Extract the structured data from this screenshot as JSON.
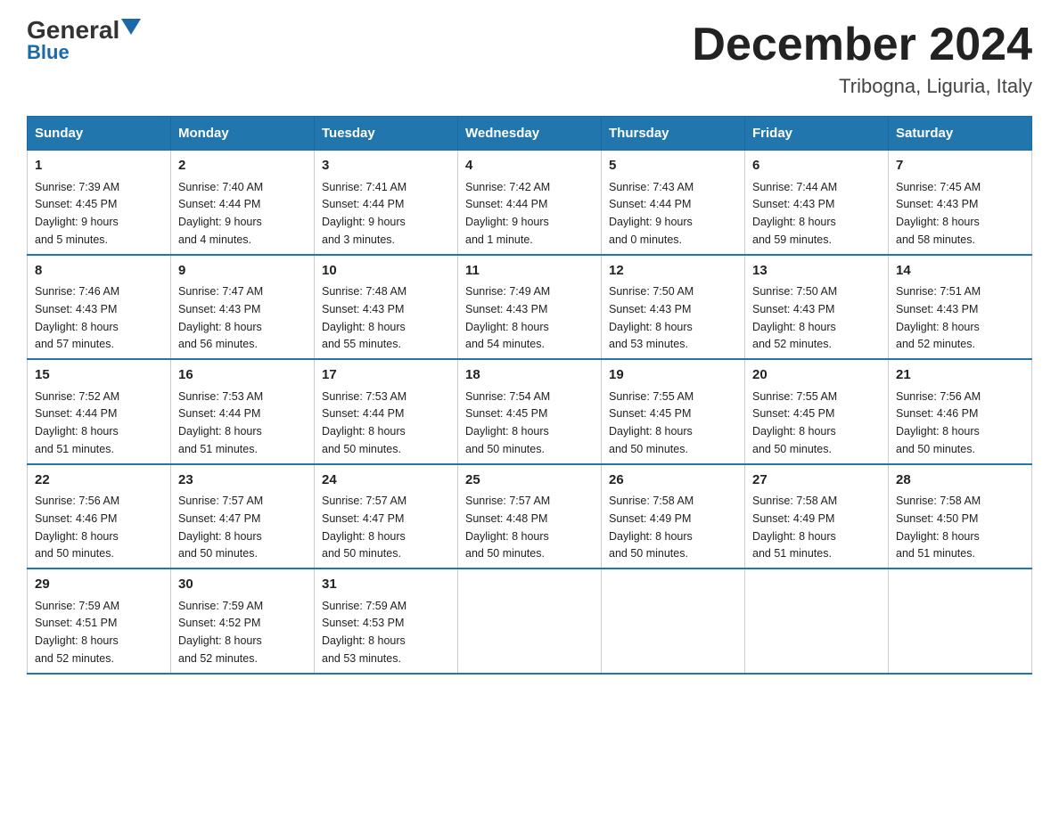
{
  "logo": {
    "general": "General",
    "blue": "Blue"
  },
  "title": "December 2024",
  "subtitle": "Tribogna, Liguria, Italy",
  "weekdays": [
    "Sunday",
    "Monday",
    "Tuesday",
    "Wednesday",
    "Thursday",
    "Friday",
    "Saturday"
  ],
  "weeks": [
    [
      {
        "day": "1",
        "sunrise": "7:39 AM",
        "sunset": "4:45 PM",
        "daylight": "9 hours and 5 minutes."
      },
      {
        "day": "2",
        "sunrise": "7:40 AM",
        "sunset": "4:44 PM",
        "daylight": "9 hours and 4 minutes."
      },
      {
        "day": "3",
        "sunrise": "7:41 AM",
        "sunset": "4:44 PM",
        "daylight": "9 hours and 3 minutes."
      },
      {
        "day": "4",
        "sunrise": "7:42 AM",
        "sunset": "4:44 PM",
        "daylight": "9 hours and 1 minute."
      },
      {
        "day": "5",
        "sunrise": "7:43 AM",
        "sunset": "4:44 PM",
        "daylight": "9 hours and 0 minutes."
      },
      {
        "day": "6",
        "sunrise": "7:44 AM",
        "sunset": "4:43 PM",
        "daylight": "8 hours and 59 minutes."
      },
      {
        "day": "7",
        "sunrise": "7:45 AM",
        "sunset": "4:43 PM",
        "daylight": "8 hours and 58 minutes."
      }
    ],
    [
      {
        "day": "8",
        "sunrise": "7:46 AM",
        "sunset": "4:43 PM",
        "daylight": "8 hours and 57 minutes."
      },
      {
        "day": "9",
        "sunrise": "7:47 AM",
        "sunset": "4:43 PM",
        "daylight": "8 hours and 56 minutes."
      },
      {
        "day": "10",
        "sunrise": "7:48 AM",
        "sunset": "4:43 PM",
        "daylight": "8 hours and 55 minutes."
      },
      {
        "day": "11",
        "sunrise": "7:49 AM",
        "sunset": "4:43 PM",
        "daylight": "8 hours and 54 minutes."
      },
      {
        "day": "12",
        "sunrise": "7:50 AM",
        "sunset": "4:43 PM",
        "daylight": "8 hours and 53 minutes."
      },
      {
        "day": "13",
        "sunrise": "7:50 AM",
        "sunset": "4:43 PM",
        "daylight": "8 hours and 52 minutes."
      },
      {
        "day": "14",
        "sunrise": "7:51 AM",
        "sunset": "4:43 PM",
        "daylight": "8 hours and 52 minutes."
      }
    ],
    [
      {
        "day": "15",
        "sunrise": "7:52 AM",
        "sunset": "4:44 PM",
        "daylight": "8 hours and 51 minutes."
      },
      {
        "day": "16",
        "sunrise": "7:53 AM",
        "sunset": "4:44 PM",
        "daylight": "8 hours and 51 minutes."
      },
      {
        "day": "17",
        "sunrise": "7:53 AM",
        "sunset": "4:44 PM",
        "daylight": "8 hours and 50 minutes."
      },
      {
        "day": "18",
        "sunrise": "7:54 AM",
        "sunset": "4:45 PM",
        "daylight": "8 hours and 50 minutes."
      },
      {
        "day": "19",
        "sunrise": "7:55 AM",
        "sunset": "4:45 PM",
        "daylight": "8 hours and 50 minutes."
      },
      {
        "day": "20",
        "sunrise": "7:55 AM",
        "sunset": "4:45 PM",
        "daylight": "8 hours and 50 minutes."
      },
      {
        "day": "21",
        "sunrise": "7:56 AM",
        "sunset": "4:46 PM",
        "daylight": "8 hours and 50 minutes."
      }
    ],
    [
      {
        "day": "22",
        "sunrise": "7:56 AM",
        "sunset": "4:46 PM",
        "daylight": "8 hours and 50 minutes."
      },
      {
        "day": "23",
        "sunrise": "7:57 AM",
        "sunset": "4:47 PM",
        "daylight": "8 hours and 50 minutes."
      },
      {
        "day": "24",
        "sunrise": "7:57 AM",
        "sunset": "4:47 PM",
        "daylight": "8 hours and 50 minutes."
      },
      {
        "day": "25",
        "sunrise": "7:57 AM",
        "sunset": "4:48 PM",
        "daylight": "8 hours and 50 minutes."
      },
      {
        "day": "26",
        "sunrise": "7:58 AM",
        "sunset": "4:49 PM",
        "daylight": "8 hours and 50 minutes."
      },
      {
        "day": "27",
        "sunrise": "7:58 AM",
        "sunset": "4:49 PM",
        "daylight": "8 hours and 51 minutes."
      },
      {
        "day": "28",
        "sunrise": "7:58 AM",
        "sunset": "4:50 PM",
        "daylight": "8 hours and 51 minutes."
      }
    ],
    [
      {
        "day": "29",
        "sunrise": "7:59 AM",
        "sunset": "4:51 PM",
        "daylight": "8 hours and 52 minutes."
      },
      {
        "day": "30",
        "sunrise": "7:59 AM",
        "sunset": "4:52 PM",
        "daylight": "8 hours and 52 minutes."
      },
      {
        "day": "31",
        "sunrise": "7:59 AM",
        "sunset": "4:53 PM",
        "daylight": "8 hours and 53 minutes."
      },
      null,
      null,
      null,
      null
    ]
  ],
  "labels": {
    "sunrise": "Sunrise:",
    "sunset": "Sunset:",
    "daylight": "Daylight:"
  }
}
